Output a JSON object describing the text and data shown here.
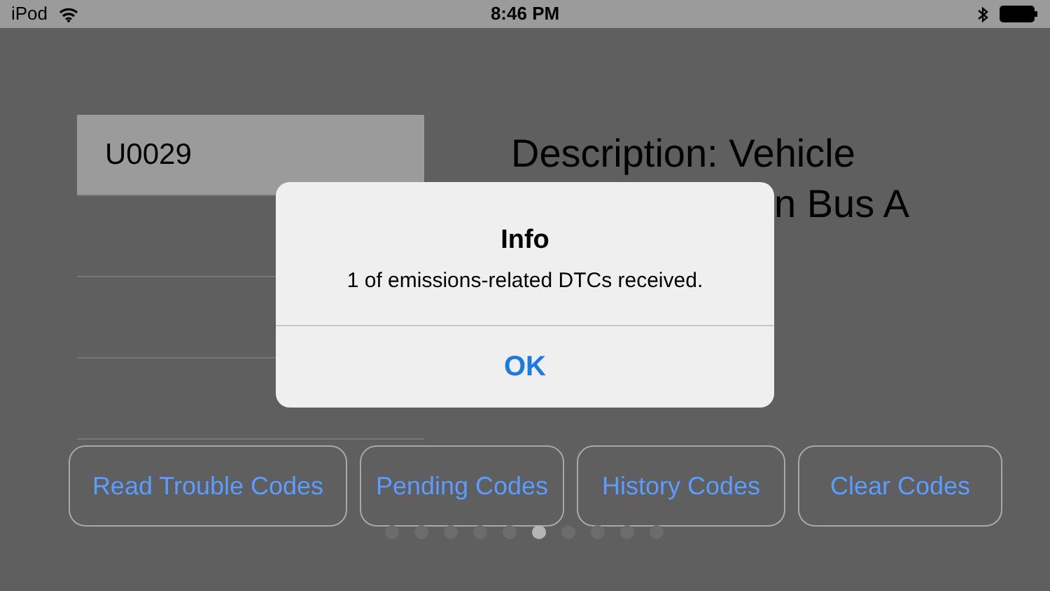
{
  "status_bar": {
    "device": "iPod",
    "time": "8:46 PM"
  },
  "codes": [
    {
      "code": "U0029",
      "selected": true
    }
  ],
  "description": {
    "line_1": "Description: Vehicle",
    "line_2": "n Bus A"
  },
  "buttons": [
    "Read Trouble Codes",
    "Pending Codes",
    "History Codes",
    "Clear Codes"
  ],
  "pager": [
    {
      "selected": false
    },
    {
      "selected": false
    },
    {
      "selected": false
    },
    {
      "selected": false
    },
    {
      "selected": false
    },
    {
      "selected": true
    },
    {
      "selected": false
    },
    {
      "selected": false
    },
    {
      "selected": false
    },
    {
      "selected": false
    }
  ],
  "alert": {
    "title": "Info",
    "message": "1 of emissions-related DTCs received.",
    "button": "OK"
  }
}
